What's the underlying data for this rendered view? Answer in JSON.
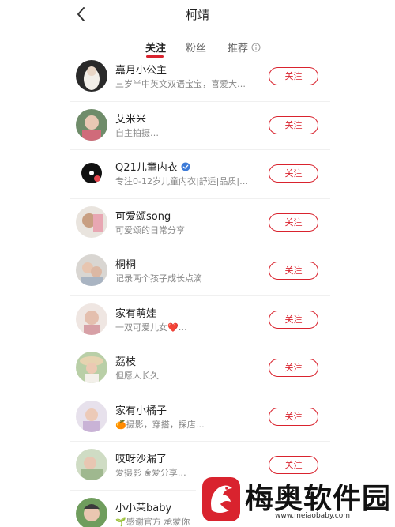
{
  "header": {
    "title": "柯靖",
    "back_icon": "chevron-left-icon"
  },
  "tabs": [
    {
      "label": "关注",
      "active": true
    },
    {
      "label": "粉丝",
      "active": false
    },
    {
      "label": "推荐",
      "active": false,
      "icon": "info-circle-icon"
    }
  ],
  "accent_color": "#d9232e",
  "users": [
    {
      "name": "嘉月小公主",
      "desc": "三岁半中英文双语宝宝，喜爱大…",
      "button": "关注",
      "verified": false
    },
    {
      "name": "艾米米",
      "desc": "自主拍摄…",
      "button": "关注",
      "verified": false
    },
    {
      "name": "Q21儿童内衣",
      "desc": "专注0-12岁儿童内衣|舒适|品质|…",
      "button": "关注",
      "verified": true
    },
    {
      "name": "可爱颂song",
      "desc": "可爱颂的日常分享",
      "button": "关注",
      "verified": false
    },
    {
      "name": "桐桐",
      "desc": "记录两个孩子成长点滴",
      "button": "关注",
      "verified": false
    },
    {
      "name": "家有萌娃",
      "desc": "一双可爱儿女❤️…",
      "button": "关注",
      "verified": false
    },
    {
      "name": "荔枝",
      "desc": "但愿人长久",
      "button": "关注",
      "verified": false
    },
    {
      "name": "家有小橘子",
      "desc": "🍊摄影，穿搭，探店…",
      "button": "关注",
      "verified": false
    },
    {
      "name": "哎呀沙漏了",
      "desc": "爱摄影 ❀爱分享…",
      "button": "关注",
      "verified": false
    },
    {
      "name": "小小茉baby",
      "desc": "🌱感谢官方 承蒙你",
      "button": "关注",
      "verified": false
    }
  ],
  "watermark": {
    "text": "梅奥软件园",
    "url": "www.meiaobaby.com"
  }
}
